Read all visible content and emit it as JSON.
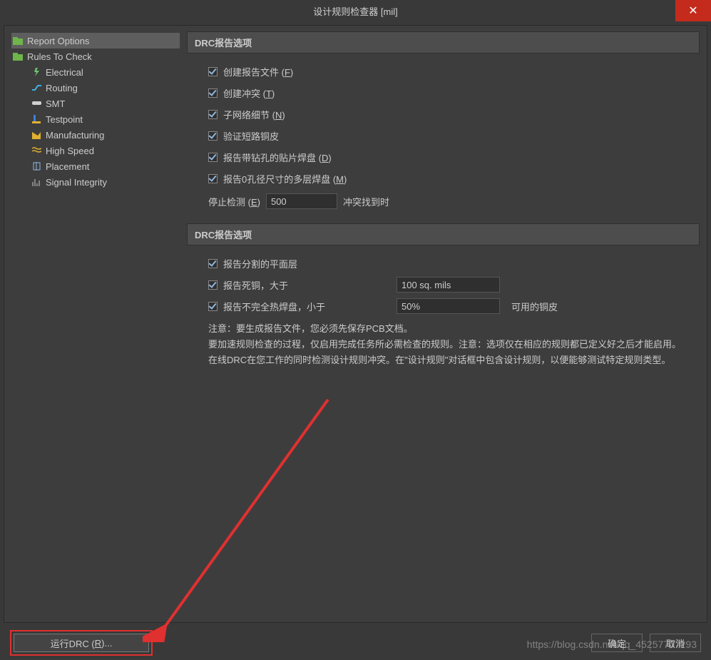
{
  "title": "设计规则检查器 [mil]",
  "sidebar": {
    "items": [
      {
        "label": "Report Options",
        "selected": true,
        "child": false
      },
      {
        "label": "Rules To Check",
        "selected": false,
        "child": false
      },
      {
        "label": "Electrical",
        "selected": false,
        "child": true
      },
      {
        "label": "Routing",
        "selected": false,
        "child": true
      },
      {
        "label": "SMT",
        "selected": false,
        "child": true
      },
      {
        "label": "Testpoint",
        "selected": false,
        "child": true
      },
      {
        "label": "Manufacturing",
        "selected": false,
        "child": true
      },
      {
        "label": "High Speed",
        "selected": false,
        "child": true
      },
      {
        "label": "Placement",
        "selected": false,
        "child": true
      },
      {
        "label": "Signal Integrity",
        "selected": false,
        "child": true
      }
    ]
  },
  "section1": {
    "header": "DRC报告选项",
    "c1_pre": "创建报告文件 (",
    "c1_u": "F",
    "c1_post": ")",
    "c2_pre": "创建冲突 (",
    "c2_u": "T",
    "c2_post": ")",
    "c3_pre": "子网络细节 (",
    "c3_u": "N",
    "c3_post": ")",
    "c4": "验证短路铜皮",
    "c5_pre": "报告带钻孔的贴片焊盘 (",
    "c5_u": "D",
    "c5_post": ")",
    "c6_pre": "报告0孔径尺寸的多层焊盘 (",
    "c6_u": "M",
    "c6_post": ")",
    "stop_label_pre": "停止检测 (",
    "stop_label_u": "E",
    "stop_label_post": ")",
    "stop_value": "500",
    "stop_trail": "冲突找到时"
  },
  "section2": {
    "header": "DRC报告选项",
    "c1": "报告分割的平面层",
    "c2": "报告死铜，大于",
    "c2_val": "100 sq. mils",
    "c3": "报告不完全热焊盘，小于",
    "c3_val": "50%",
    "c3_trail": "可用的铜皮"
  },
  "note": {
    "l1": "注意：要生成报告文件，您必须先保存PCB文档。",
    "l2": "要加速规则检查的过程，仅启用完成任务所必需检查的规则。注意：选项仅在相应的规则都已定义好之后才能启用。",
    "l3": "在线DRC在您工作的同时检测设计规则冲突。在\"设计规则\"对话框中包含设计规则，以便能够测试特定规则类型。"
  },
  "buttons": {
    "run_pre": "运行DRC (",
    "run_u": "R",
    "run_post": ")...",
    "ok": "确定",
    "cancel": "取消"
  },
  "watermark": "https://blog.csdn.net/qq_45257707293"
}
